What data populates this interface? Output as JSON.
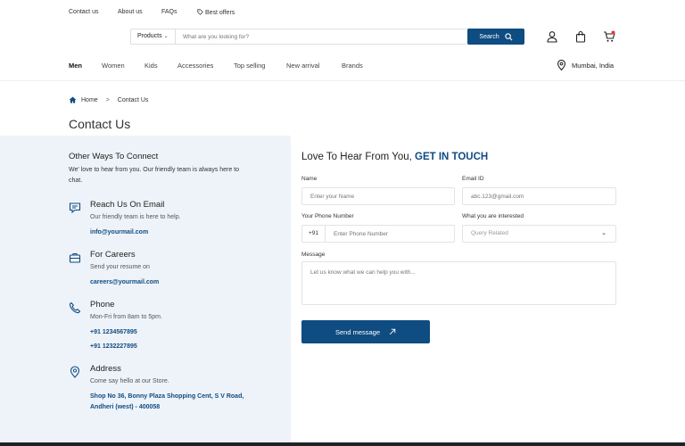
{
  "topbar": {
    "contact_us": "Contact us",
    "about_us": "About us",
    "faqs": "FAQs",
    "best_offers": "Best offers"
  },
  "search": {
    "category": "Products",
    "placeholder": "What are you looking for?",
    "button_label": "Search"
  },
  "nav": {
    "items": [
      "Men",
      "Women",
      "Kids",
      "Accessories",
      "Top selling",
      "New arrival",
      "Brands"
    ],
    "active": "Men",
    "location": "Mumbai, India"
  },
  "breadcrumb": {
    "home": "Home",
    "separator": ">",
    "current": "Contact Us"
  },
  "page_title": "Contact Us",
  "left": {
    "title": "Other Ways To Connect",
    "description": "We' love to hear from you. Our friendly team is always here to chat.",
    "email": {
      "title": "Reach Us On Email",
      "subtitle": "Our friendly team is here to help.",
      "link": "info@yourmail.com"
    },
    "careers": {
      "title": "For Careers",
      "subtitle": "Send your resume on",
      "link": "careers@yourmail.com"
    },
    "phone": {
      "title": "Phone",
      "subtitle": "Mon-Fri from 8am to 5pm.",
      "numbers": [
        "+91 1234567895",
        "+91 1232227895"
      ]
    },
    "address": {
      "title": "Address",
      "subtitle": "Come say hello at our Store.",
      "line1": "Shop No 36, Bonny Plaza Shopping Cent, S V Road,",
      "line2": "Andheri (west)  -  400058"
    }
  },
  "form": {
    "title_plain": "Love To Hear From You,",
    "title_accent": "GET IN TOUCH",
    "name_label": "Name",
    "name_placeholder": "Enter your Name",
    "email_label": "Email ID",
    "email_placeholder": "abc.123@gmail.com",
    "phone_label": "Your Phone Number",
    "phone_code": "+91",
    "phone_placeholder": "Enter Phone Number",
    "interest_label": "What you are interested",
    "interest_value": "Query Related",
    "message_label": "Message",
    "message_placeholder": "Let us know what we can help you with...",
    "send_label": "Send message"
  },
  "colors": {
    "primary": "#0f4c81",
    "panel": "#eef3f9",
    "cart_badge": "#e53935"
  },
  "icons": {
    "best_offers": "tag-icon",
    "search": "search-icon",
    "user": "user-icon",
    "bag": "shopping-bag-icon",
    "cart": "cart-icon",
    "location": "location-pin-icon",
    "home": "home-icon",
    "chat": "chat-icon",
    "briefcase": "briefcase-icon",
    "phone": "phone-icon",
    "arrow": "arrow-up-right-icon"
  }
}
